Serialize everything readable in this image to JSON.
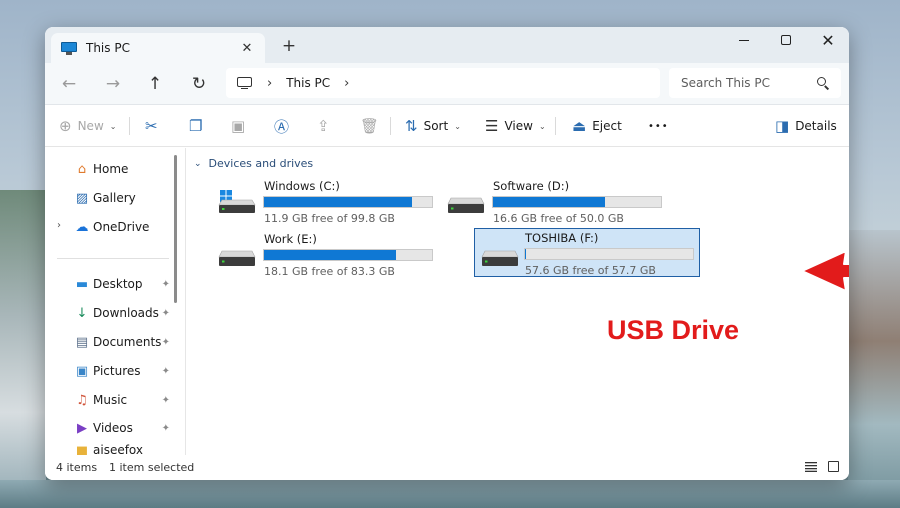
{
  "window": {
    "tab_title": "This PC",
    "new_tab_glyph": "+",
    "close_tab_glyph": "✕",
    "close_glyph": "✕"
  },
  "nav": {
    "back_glyph": "←",
    "forward_glyph": "→",
    "up_glyph": "↑",
    "refresh_glyph": "↻",
    "chevron_glyph": "›",
    "breadcrumb": [
      "This PC"
    ],
    "search_placeholder": "Search This PC"
  },
  "toolbar": {
    "new_label": "New",
    "sort_label": "Sort",
    "view_label": "View",
    "eject_label": "Eject",
    "more_glyph": "•••",
    "details_label": "Details",
    "caret_glyph": "⌄"
  },
  "sidebar": {
    "items": [
      {
        "label": "Home",
        "icon": "home-icon"
      },
      {
        "label": "Gallery",
        "icon": "gallery-icon"
      },
      {
        "label": "OneDrive",
        "icon": "cloud-icon"
      },
      {
        "label": "Desktop",
        "icon": "desktop-icon"
      },
      {
        "label": "Downloads",
        "icon": "download-icon"
      },
      {
        "label": "Documents",
        "icon": "documents-icon"
      },
      {
        "label": "Pictures",
        "icon": "pictures-icon"
      },
      {
        "label": "Music",
        "icon": "music-icon"
      },
      {
        "label": "Videos",
        "icon": "videos-icon"
      },
      {
        "label": "aiseefox",
        "icon": "folder-icon"
      }
    ],
    "expander_glyph": "›",
    "pin_glyph": "📌"
  },
  "content": {
    "section_title": "Devices and drives",
    "section_chevron": "⌄",
    "drives": [
      {
        "name": "Windows (C:)",
        "free_text": "11.9 GB free of 99.8 GB",
        "used_fraction": 0.881,
        "type": "system"
      },
      {
        "name": "Software (D:)",
        "free_text": "16.6 GB free of 50.0 GB",
        "used_fraction": 0.668,
        "type": "hdd"
      },
      {
        "name": "Work (E:)",
        "free_text": "18.1 GB free of 83.3 GB",
        "used_fraction": 0.783,
        "type": "hdd"
      },
      {
        "name": "TOSHIBA (F:)",
        "free_text": "57.6 GB free of 57.7 GB",
        "used_fraction": 0.002,
        "type": "usb",
        "selected": true
      }
    ]
  },
  "annotation": {
    "label": "USB Drive",
    "color": "#e21b1b"
  },
  "status": {
    "item_count": "4 items",
    "selection": "1 item selected"
  },
  "colors": {
    "accent": "#0f78d4",
    "selection_bg": "#cfe4f7",
    "selection_border": "#1f5fa5"
  }
}
